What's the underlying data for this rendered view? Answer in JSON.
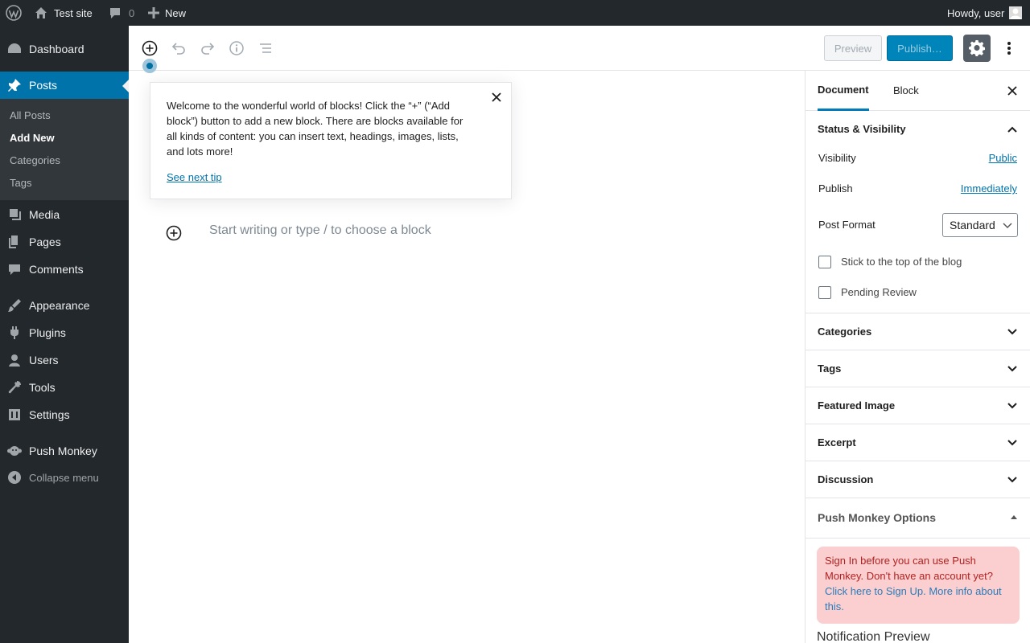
{
  "admin_bar": {
    "site_name": "Test site",
    "comments_count": "0",
    "new_label": "New",
    "greeting": "Howdy, user"
  },
  "admin_menu": {
    "dashboard": "Dashboard",
    "posts": "Posts",
    "submenu": [
      "All Posts",
      "Add New",
      "Categories",
      "Tags"
    ],
    "media": "Media",
    "pages": "Pages",
    "comments": "Comments",
    "appearance": "Appearance",
    "plugins": "Plugins",
    "users": "Users",
    "tools": "Tools",
    "settings": "Settings",
    "push_monkey": "Push Monkey",
    "collapse": "Collapse menu"
  },
  "toolbar": {
    "preview_label": "Preview",
    "publish_label": "Publish…"
  },
  "tip": {
    "text": "Welcome to the wonderful world of blocks! Click the “+” (“Add block”) button to add a new block. There are blocks available for all kinds of content: you can insert text, headings, images, lists, and lots more!",
    "link": "See next tip"
  },
  "editor": {
    "placeholder": "Start writing or type / to choose a block"
  },
  "sidebar": {
    "tabs": [
      "Document",
      "Block"
    ],
    "status": {
      "title": "Status & Visibility",
      "visibility_label": "Visibility",
      "visibility_value": "Public",
      "publish_label": "Publish",
      "publish_value": "Immediately",
      "format_label": "Post Format",
      "format_value": "Standard",
      "sticky_label": "Stick to the top of the blog",
      "pending_label": "Pending Review"
    },
    "panels": [
      "Categories",
      "Tags",
      "Featured Image",
      "Excerpt",
      "Discussion"
    ],
    "push_monkey": {
      "title": "Push Monkey Options",
      "notice_text": "Sign In before you can use Push Monkey. Don't have an account yet?",
      "notice_link": "Click here to Sign Up. More info about this.",
      "preview_title": "Notification Preview"
    }
  }
}
